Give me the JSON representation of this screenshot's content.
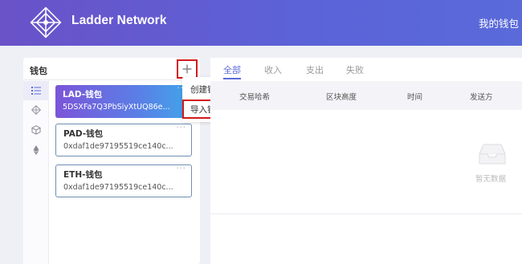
{
  "header": {
    "app_title": "Ladder Network",
    "nav_wallet": "我的钱包",
    "brand_color": "#5b63d8",
    "logo_icon": "ladder-diamond-logo"
  },
  "wallet_panel": {
    "title": "钱包",
    "add_icon": "plus-icon",
    "rail_icons": [
      "list-icon",
      "diamond-icon",
      "cube-icon",
      "ethereum-icon"
    ],
    "wallets": [
      {
        "name": "LAD-钱包",
        "address": "5DSXFa7Q3PbSiyXtUQ86e...",
        "more": "···",
        "active": true
      },
      {
        "name": "PAD-钱包",
        "address": "0xdaf1de97195519ce140c...",
        "more": "···",
        "active": false
      },
      {
        "name": "ETH-钱包",
        "address": "0xdaf1de97195519ce140c...",
        "more": "···",
        "active": false
      }
    ]
  },
  "dropdown": {
    "create": "创建钱包",
    "import": "导入钱包"
  },
  "tx_panel": {
    "tabs": [
      "全部",
      "收入",
      "支出",
      "失败"
    ],
    "columns": [
      "交易哈希",
      "区块高度",
      "时间",
      "发送方"
    ],
    "empty_text": "暂无数据",
    "accent_color": "#5a6ad9"
  }
}
